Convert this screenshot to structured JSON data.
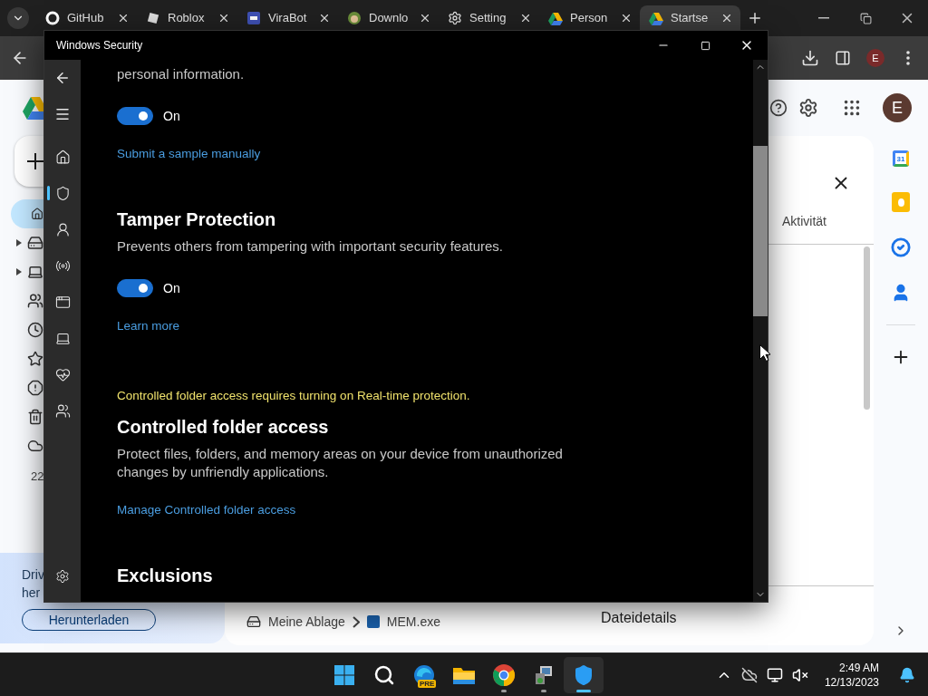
{
  "browser": {
    "tabs": [
      {
        "label": "GitHub",
        "selected": false
      },
      {
        "label": "Roblox",
        "selected": false
      },
      {
        "label": "ViraBot",
        "selected": false
      },
      {
        "label": "Downlo",
        "selected": false
      },
      {
        "label": "Setting",
        "selected": false
      },
      {
        "label": "Person",
        "selected": false
      },
      {
        "label": "Startse",
        "selected": true
      }
    ],
    "profile_initial": "E"
  },
  "drive": {
    "account_initial": "E",
    "nav": [
      {
        "selected": true,
        "expandable": false
      },
      {
        "selected": false,
        "expandable": true
      },
      {
        "selected": false,
        "expandable": true
      },
      {
        "selected": false,
        "expandable": false
      },
      {
        "selected": false,
        "expandable": false
      },
      {
        "selected": false,
        "expandable": false
      },
      {
        "selected": false,
        "expandable": false
      },
      {
        "selected": false,
        "expandable": false
      },
      {
        "selected": false,
        "expandable": false
      }
    ],
    "storage_text": "22",
    "promo_lines": [
      "Driv",
      "her"
    ],
    "promo_button": "Herunterladen",
    "breadcrumb": [
      "Meine Ablage",
      "MEM.exe"
    ],
    "details": {
      "tab": "Aktivität",
      "footer": "Dateidetails"
    },
    "calendar_day": "31"
  },
  "security": {
    "title": "Windows Security",
    "nav": [
      {
        "selected": false
      },
      {
        "selected": true
      },
      {
        "selected": false
      },
      {
        "selected": false
      },
      {
        "selected": false
      },
      {
        "selected": false
      },
      {
        "selected": false
      },
      {
        "selected": false
      }
    ],
    "blocks": [
      {
        "kind": "text",
        "text": "personal information."
      },
      {
        "kind": "toggle",
        "on": true,
        "label": "On"
      },
      {
        "kind": "link",
        "text": "Submit a sample manually"
      },
      {
        "kind": "heading",
        "text": "Tamper Protection"
      },
      {
        "kind": "text",
        "text": "Prevents others from tampering with important security features."
      },
      {
        "kind": "toggle",
        "on": true,
        "label": "On"
      },
      {
        "kind": "link",
        "text": "Learn more"
      },
      {
        "kind": "warning",
        "text": "Controlled folder access requires turning on Real-time protection."
      },
      {
        "kind": "heading",
        "text": "Controlled folder access"
      },
      {
        "kind": "text",
        "text": "Protect files, folders, and memory areas on your device from unauthorized changes by unfriendly applications."
      },
      {
        "kind": "link",
        "text": "Manage Controlled folder access"
      },
      {
        "kind": "heading",
        "text": "Exclusions"
      }
    ]
  },
  "taskbar": {
    "apps": [
      {
        "running": false,
        "active": false
      },
      {
        "running": false,
        "active": false
      },
      {
        "running": false,
        "active": false,
        "badge": "PRE"
      },
      {
        "running": false,
        "active": false
      },
      {
        "running": true,
        "active": false
      },
      {
        "running": true,
        "active": false
      },
      {
        "running": true,
        "active": true
      }
    ],
    "time": "2:49 AM",
    "date": "12/13/2023"
  }
}
